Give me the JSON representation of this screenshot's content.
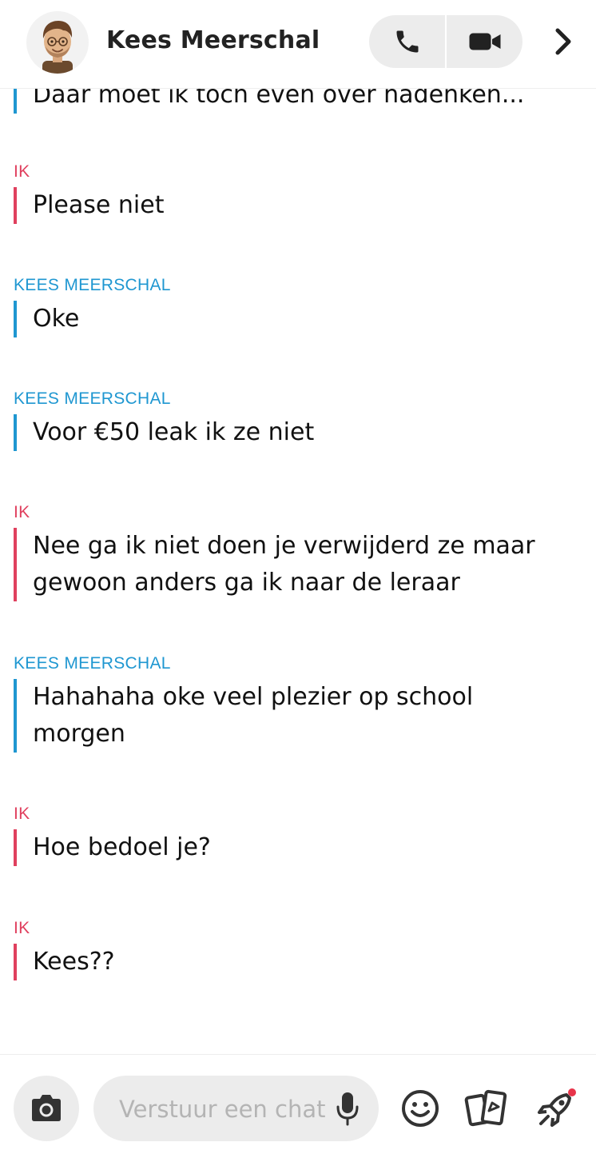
{
  "header": {
    "contact_name": "Kees Meerschal",
    "avatar_icon": "bitmoji-avatar",
    "call_icon": "phone-icon",
    "video_icon": "video-camera-icon",
    "more_icon": "chevron-right-icon"
  },
  "messages": [
    {
      "sender": "",
      "from": "them",
      "text": "Daar moet ik toch even over nadenken..."
    },
    {
      "sender": "IK",
      "from": "me",
      "text": "Please niet"
    },
    {
      "sender": "KEES MEERSCHAL",
      "from": "them",
      "text": "Oke"
    },
    {
      "sender": "KEES MEERSCHAL",
      "from": "them",
      "text": "Voor €50 leak ik ze niet"
    },
    {
      "sender": "IK",
      "from": "me",
      "text": "Nee ga ik niet doen je verwijderd ze maar gewoon anders ga ik naar de leraar"
    },
    {
      "sender": "KEES MEERSCHAL",
      "from": "them",
      "text": "Hahahaha oke veel plezier op school morgen"
    },
    {
      "sender": "IK",
      "from": "me",
      "text": "Hoe bedoel je?"
    },
    {
      "sender": "IK",
      "from": "me",
      "text": "Kees??"
    }
  ],
  "composer": {
    "placeholder": "Verstuur een chat",
    "camera_icon": "camera-icon",
    "mic_icon": "microphone-icon",
    "emoji_icon": "smiley-icon",
    "cards_icon": "cards-icon",
    "rocket_icon": "rocket-icon"
  },
  "colors": {
    "me": "#e0405e",
    "them": "#1f97d1",
    "notification_dot": "#e8344a"
  }
}
